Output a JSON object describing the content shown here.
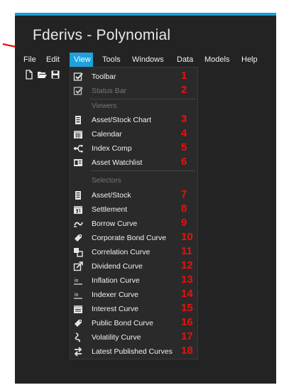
{
  "window": {
    "title": "Fderivs - Polynomial"
  },
  "menubar": {
    "items": [
      {
        "label": "File"
      },
      {
        "label": "Edit"
      },
      {
        "label": "View"
      },
      {
        "label": "Tools"
      },
      {
        "label": "Windows"
      },
      {
        "label": "Data"
      },
      {
        "label": "Models"
      },
      {
        "label": "Help"
      }
    ]
  },
  "toolbar": {
    "icons": [
      "new-file-icon",
      "open-folder-icon",
      "save-icon"
    ]
  },
  "view_menu": {
    "toolbar": {
      "label": "Toolbar",
      "checked": true,
      "number": "1"
    },
    "status_bar": {
      "label": "Status Bar",
      "checked": true,
      "disabled": true,
      "number": "2"
    },
    "viewers_header": "Viewers",
    "viewers": [
      {
        "label": "Asset/Stock Chart",
        "icon": "chart-doc-icon",
        "number": "3"
      },
      {
        "label": "Calendar",
        "icon": "calendar-icon",
        "number": "4"
      },
      {
        "label": "Index Comp",
        "icon": "branch-icon",
        "number": "5"
      },
      {
        "label": "Asset Watchlist",
        "icon": "watchlist-icon",
        "number": "6"
      }
    ],
    "selectors_header": "Selectors",
    "selectors": [
      {
        "label": "Asset/Stock",
        "icon": "doc-list-icon",
        "number": "7"
      },
      {
        "label": "Settlement",
        "icon": "calendar-31-icon",
        "number": "8"
      },
      {
        "label": "Borrow Curve",
        "icon": "borrow-curve-icon",
        "number": "9"
      },
      {
        "label": "Corporate Bond Curve",
        "icon": "corporate-bond-icon",
        "number": "10"
      },
      {
        "label": "Correlation Curve",
        "icon": "correlation-icon",
        "number": "11"
      },
      {
        "label": "Dividend Curve",
        "icon": "dividend-icon",
        "number": "12"
      },
      {
        "label": "Inflation Curve",
        "icon": "inflation-icon",
        "number": "13"
      },
      {
        "label": "Indexer Curve",
        "icon": "indexer-icon",
        "number": "14"
      },
      {
        "label": "Interest Curve",
        "icon": "interest-icon",
        "number": "15"
      },
      {
        "label": "Public Bond Curve",
        "icon": "public-bond-icon",
        "number": "16"
      },
      {
        "label": "Volatility Curve",
        "icon": "volatility-icon",
        "number": "17"
      },
      {
        "label": "Latest Published Curves",
        "icon": "latest-curves-icon",
        "number": "18"
      }
    ]
  },
  "colors": {
    "accent": "#1ea1dc",
    "window_bg": "#232323",
    "menu_bg": "#2a2a2a",
    "annotation": "#e8120c"
  }
}
